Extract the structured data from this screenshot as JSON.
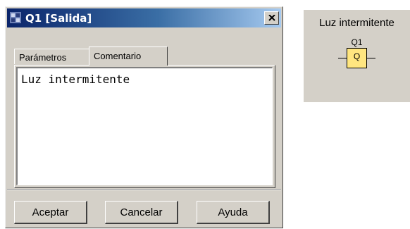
{
  "window": {
    "title": "Q1 [Salida]"
  },
  "tabs": [
    {
      "label": "Parámetros",
      "active": false
    },
    {
      "label": "Comentario",
      "active": true
    }
  ],
  "comment": {
    "value": "Luz intermitente"
  },
  "buttons": {
    "ok": "Aceptar",
    "cancel": "Cancelar",
    "help": "Ayuda"
  },
  "preview": {
    "label": "Luz intermitente",
    "block_name": "Q1",
    "block_symbol": "Q",
    "block_color": "#ffe680"
  },
  "icons": {
    "app": "app-icon",
    "close": "close-icon"
  }
}
